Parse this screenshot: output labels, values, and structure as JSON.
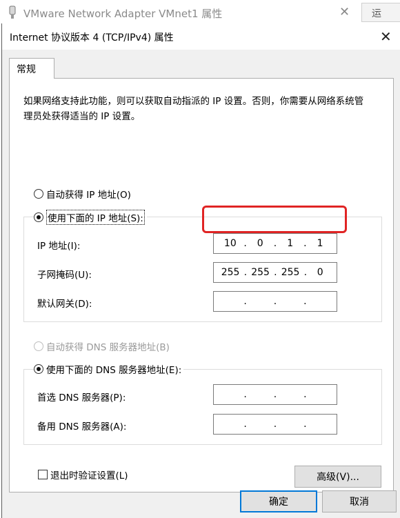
{
  "background_window": {
    "title": "VMware Network Adapter VMnet1 属性",
    "side_button_label": "运"
  },
  "dialog": {
    "title": "Internet 协议版本 4 (TCP/IPv4) 属性",
    "tab_label": "常规",
    "description": "如果网络支持此功能，则可以获取自动指派的 IP 设置。否则，你需要从网络系统管理员处获得适当的 IP 设置。",
    "ip_section": {
      "auto_label": "自动获得 IP 地址(O)",
      "manual_label": "使用下面的 IP 地址(S):",
      "ip_label": "IP 地址(I):",
      "ip_value": [
        "10",
        "0",
        "1",
        "1"
      ],
      "mask_label": "子网掩码(U):",
      "mask_value": [
        "255",
        "255",
        "255",
        "0"
      ],
      "gateway_label": "默认网关(D):",
      "gateway_value": [
        "",
        "",
        "",
        ""
      ]
    },
    "dns_section": {
      "auto_label": "自动获得 DNS 服务器地址(B)",
      "manual_label": "使用下面的 DNS 服务器地址(E):",
      "preferred_label": "首选 DNS 服务器(P):",
      "preferred_value": [
        "",
        "",
        "",
        ""
      ],
      "alternate_label": "备用 DNS 服务器(A):",
      "alternate_value": [
        "",
        "",
        "",
        ""
      ]
    },
    "validate_label": "退出时验证设置(L)",
    "advanced_label": "高级(V)...",
    "ok_label": "确定",
    "cancel_label": "取消"
  },
  "colors": {
    "highlight": "#e02424",
    "primary_button_border": "#0078d7"
  }
}
